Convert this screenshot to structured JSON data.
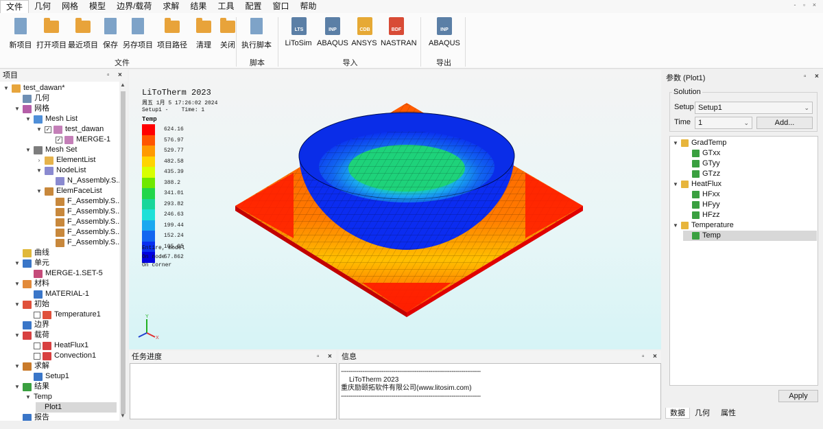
{
  "menu": [
    "文件",
    "几何",
    "网格",
    "模型",
    "边界/载荷",
    "求解",
    "结果",
    "工具",
    "配置",
    "窗口",
    "帮助"
  ],
  "window_controls": "- ▫ ×",
  "ribbon": {
    "file_group": {
      "label": "文件",
      "buttons": [
        "新项目",
        "打开项目",
        "最近项目",
        "保存",
        "另存项目",
        "项目路径",
        "清理",
        "关闭"
      ]
    },
    "script_group": {
      "label": "脚本",
      "buttons": [
        "执行脚本"
      ]
    },
    "import_group": {
      "label": "导入",
      "buttons": [
        {
          "label": "LiToSim",
          "badge": "LTS",
          "color": "#5b7fa6"
        },
        {
          "label": "ABAQUS",
          "badge": "INP",
          "color": "#5b7fa6"
        },
        {
          "label": "ANSYS",
          "badge": "CDB",
          "color": "#e6a935"
        },
        {
          "label": "NASTRAN",
          "badge": "BDF",
          "color": "#d84b36"
        }
      ]
    },
    "export_group": {
      "label": "导出",
      "buttons": [
        {
          "label": "ABAQUS",
          "badge": "INP",
          "color": "#5b7fa6"
        }
      ]
    }
  },
  "project_panel": {
    "title": "项目",
    "items": [
      {
        "label": "test_dawan*",
        "lvl": 0,
        "tw": "▼",
        "icon": "pencil-icon",
        "color": "#e7a53c"
      },
      {
        "label": "几何",
        "lvl": 1,
        "tw": "",
        "icon": "cube-icon",
        "color": "#6f8fb3"
      },
      {
        "label": "网格",
        "lvl": 1,
        "tw": "▼",
        "icon": "grid-icon",
        "color": "#b55ea8"
      },
      {
        "label": "Mesh List",
        "lvl": 2,
        "tw": "▼",
        "icon": "database-icon",
        "color": "#4f8fd8"
      },
      {
        "label": "test_dawan",
        "lvl": 3,
        "tw": "▼",
        "cb": "✓",
        "icon": "mesh-icon",
        "color": "#c47fb8"
      },
      {
        "label": "MERGE-1",
        "lvl": 4,
        "tw": "",
        "cb": "✓",
        "icon": "mesh-icon",
        "color": "#c47fb8"
      },
      {
        "label": "Mesh Set",
        "lvl": 2,
        "tw": "▼",
        "icon": "folder-icon",
        "color": "#7d7d7d"
      },
      {
        "label": "ElementList",
        "lvl": 3,
        "tw": "›",
        "icon": "element-icon",
        "color": "#e6b34b"
      },
      {
        "label": "NodeList",
        "lvl": 3,
        "tw": "▼",
        "icon": "node-icon",
        "color": "#8a8ad0"
      },
      {
        "label": "N_Assembly.S...",
        "lvl": 4,
        "tw": "",
        "icon": "node-icon",
        "color": "#8a8ad0"
      },
      {
        "label": "ElemFaceList",
        "lvl": 3,
        "tw": "▼",
        "icon": "face-icon",
        "color": "#c8883c"
      },
      {
        "label": "F_Assembly.S...",
        "lvl": 4,
        "tw": "",
        "icon": "face-icon",
        "color": "#c8883c"
      },
      {
        "label": "F_Assembly.S...",
        "lvl": 4,
        "tw": "",
        "icon": "face-icon",
        "color": "#c8883c"
      },
      {
        "label": "F_Assembly.S...",
        "lvl": 4,
        "tw": "",
        "icon": "face-icon",
        "color": "#c8883c"
      },
      {
        "label": "F_Assembly.S...",
        "lvl": 4,
        "tw": "",
        "icon": "face-icon",
        "color": "#c8883c"
      },
      {
        "label": "F_Assembly.S...",
        "lvl": 4,
        "tw": "",
        "icon": "face-icon",
        "color": "#c8883c"
      },
      {
        "label": "曲线",
        "lvl": 1,
        "tw": "",
        "icon": "curve-icon",
        "color": "#e0b83a"
      },
      {
        "label": "单元",
        "lvl": 1,
        "tw": "▼",
        "icon": "element-type-icon",
        "color": "#3a76c8"
      },
      {
        "label": "MERGE-1.SET-5",
        "lvl": 2,
        "tw": "",
        "icon": "set-icon",
        "color": "#c54b7a"
      },
      {
        "label": "材料",
        "lvl": 1,
        "tw": "▼",
        "icon": "material-icon",
        "color": "#e28a3a"
      },
      {
        "label": "MATERIAL-1",
        "lvl": 2,
        "tw": "",
        "icon": "material-icon",
        "color": "#3a76c8"
      },
      {
        "label": "初始",
        "lvl": 1,
        "tw": "▼",
        "icon": "initial-icon",
        "color": "#e0503a"
      },
      {
        "label": "Temperature1",
        "lvl": 2,
        "tw": "",
        "cb": "",
        "icon": "temperature-icon",
        "color": "#e0503a"
      },
      {
        "label": "边界",
        "lvl": 1,
        "tw": "",
        "icon": "boundary-icon",
        "color": "#3a76c8"
      },
      {
        "label": "载荷",
        "lvl": 1,
        "tw": "▼",
        "icon": "load-icon",
        "color": "#d84040"
      },
      {
        "label": "HeatFlux1",
        "lvl": 2,
        "tw": "",
        "cb": "",
        "icon": "heatflux-icon",
        "color": "#d84040"
      },
      {
        "label": "Convection1",
        "lvl": 2,
        "tw": "",
        "cb": "",
        "icon": "convection-icon",
        "color": "#d84040"
      },
      {
        "label": "求解",
        "lvl": 1,
        "tw": "▼",
        "icon": "solve-icon",
        "color": "#c97a2a"
      },
      {
        "label": "Setup1",
        "lvl": 2,
        "tw": "",
        "icon": "setup-icon",
        "color": "#3a76c8"
      },
      {
        "label": "结果",
        "lvl": 1,
        "tw": "▼",
        "icon": "result-icon",
        "color": "#3aa040"
      },
      {
        "label": "Temp",
        "lvl": 2,
        "tw": "▼",
        "icon": "",
        "color": ""
      },
      {
        "label": "Plot1",
        "lvl": 3,
        "tw": "",
        "icon": "",
        "color": "",
        "selected": true
      },
      {
        "label": "报告",
        "lvl": 1,
        "tw": "",
        "icon": "report-icon",
        "color": "#3a76c8"
      }
    ]
  },
  "viewport": {
    "title": "LiToTherm 2023",
    "datetime": "周五 1月 5 17:26:02 2024",
    "setup_line": "Setup1 -    Time: 1",
    "legend_title": "Temp",
    "legend_values": [
      "624.16",
      "576.97",
      "529.77",
      "482.58",
      "435.39",
      "388.2",
      "341.01",
      "293.82",
      "246.63",
      "199.44",
      "152.24",
      "105.05",
      "57.862"
    ],
    "legend_colors": [
      "#ff0000",
      "#ff5500",
      "#ff9a00",
      "#ffd400",
      "#d8ff00",
      "#6fe800",
      "#22d64a",
      "#19d69a",
      "#1ee0d8",
      "#1aa8f0",
      "#1266f0",
      "#0830f0",
      "#0000e0"
    ],
    "notes": [
      "Entire, model",
      "On node",
      "On corner"
    ]
  },
  "task_panel": {
    "title": "任务进度"
  },
  "info_panel": {
    "title": "信息",
    "lines": [
      "------------------------------------------------------------------------",
      "LiToTherm 2023",
      "重庆励颐拓软件有限公司(www.litosim.com)",
      "------------------------------------------------------------------------"
    ]
  },
  "param_panel": {
    "title": "参数  (Plot1)",
    "solution_label": "Solution",
    "setup_label": "Setup",
    "setup_value": "Setup1",
    "time_label": "Time",
    "time_value": "1",
    "add_label": "Add...",
    "results": [
      {
        "label": "GradTemp",
        "lvl": 0,
        "tw": "▼",
        "icon": "folder-icon",
        "color": "#e7b53c"
      },
      {
        "label": "GTxx",
        "lvl": 1,
        "tw": "",
        "icon": "contour-icon",
        "color": "#3aa040"
      },
      {
        "label": "GTyy",
        "lvl": 1,
        "tw": "",
        "icon": "contour-icon",
        "color": "#3aa040"
      },
      {
        "label": "GTzz",
        "lvl": 1,
        "tw": "",
        "icon": "contour-icon",
        "color": "#3aa040"
      },
      {
        "label": "HeatFlux",
        "lvl": 0,
        "tw": "▼",
        "icon": "folder-icon",
        "color": "#e7b53c"
      },
      {
        "label": "HFxx",
        "lvl": 1,
        "tw": "",
        "icon": "contour-icon",
        "color": "#3aa040"
      },
      {
        "label": "HFyy",
        "lvl": 1,
        "tw": "",
        "icon": "contour-icon",
        "color": "#3aa040"
      },
      {
        "label": "HFzz",
        "lvl": 1,
        "tw": "",
        "icon": "contour-icon",
        "color": "#3aa040"
      },
      {
        "label": "Temperature",
        "lvl": 0,
        "tw": "▼",
        "icon": "folder-icon",
        "color": "#e7b53c"
      },
      {
        "label": "Temp",
        "lvl": 1,
        "tw": "",
        "icon": "contour-icon",
        "color": "#3aa040",
        "selected": true
      }
    ],
    "apply_label": "Apply",
    "tabs": [
      "数据",
      "几何",
      "属性"
    ]
  }
}
